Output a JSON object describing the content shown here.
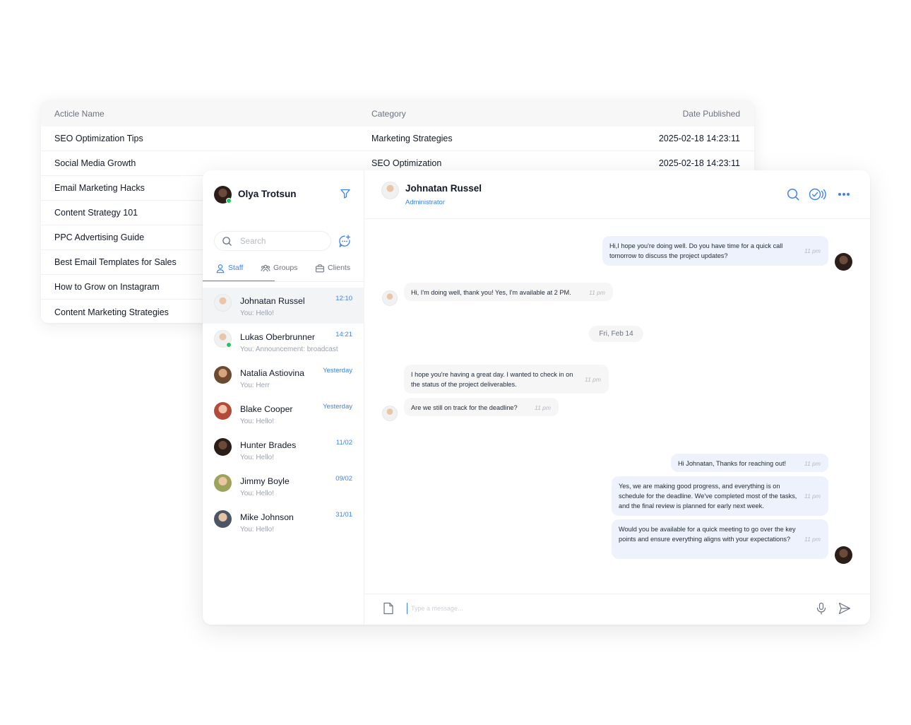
{
  "article_table": {
    "columns": [
      "Acticle Name",
      "Category",
      "Date Published"
    ],
    "rows": [
      [
        "SEO Optimization Tips",
        "Marketing Strategies",
        "2025-02-18 14:23:11"
      ],
      [
        "Social Media Growth",
        "SEO Optimization",
        "2025-02-18 14:23:11"
      ],
      [
        "Email Marketing Hacks",
        "",
        ""
      ],
      [
        "Content Strategy 101",
        "",
        ""
      ],
      [
        "PPC Advertising Guide",
        "",
        ""
      ],
      [
        "Best Email Templates for Sales",
        "",
        ""
      ],
      [
        "How to Grow on Instagram",
        "",
        ""
      ],
      [
        "Content Marketing Strategies",
        "",
        ""
      ]
    ]
  },
  "sidebar": {
    "user_name": "Olya Trotsun",
    "search_placeholder": "Search",
    "tabs": [
      {
        "label": "Staff",
        "icon": "person-icon",
        "active": true
      },
      {
        "label": "Groups",
        "icon": "group-icon",
        "active": false
      },
      {
        "label": "Clients",
        "icon": "briefcase-icon",
        "active": false
      }
    ],
    "contacts": [
      {
        "name": "Johnatan Russel",
        "preview": "You: Hello!",
        "time": "12:10",
        "active": true
      },
      {
        "name": "Lukas Oberbrunner",
        "preview": "You: Announcement: broadcast",
        "time": "14:21",
        "online": true
      },
      {
        "name": "Natalia Astiovina",
        "preview": "You: Herr",
        "time": "Yesterday"
      },
      {
        "name": "Blake Cooper",
        "preview": "You: Hello!",
        "time": "Yesterday"
      },
      {
        "name": "Hunter Brades",
        "preview": "You: Hello!",
        "time": "11/02"
      },
      {
        "name": "Jimmy Boyle",
        "preview": "You: Hello!",
        "time": "09/02"
      },
      {
        "name": "Mike Johnson",
        "preview": "You: Hello!",
        "time": "31/01"
      }
    ]
  },
  "chat": {
    "partner_name": "Johnatan Russel",
    "partner_role": "Administrator",
    "date_divider": "Fri, Feb 14",
    "input_placeholder": "Type a message...",
    "messages": [
      {
        "dir": "out",
        "text": "Hi,I hope you're doing well. Do you have time for a quick call tomorrow to discuss the project updates?",
        "time": "11 pm"
      },
      {
        "dir": "in",
        "text": "Hi, I'm doing well, thank you! Yes, I'm available at 2 PM.",
        "time": "11 pm"
      },
      {
        "dir": "in",
        "text": "I hope you're having a great day. I wanted to check in on the status of the project deliverables.",
        "time": "11 pm"
      },
      {
        "dir": "in",
        "text": "Are we still on track for the deadline?",
        "time": "11 pm"
      },
      {
        "dir": "out",
        "text": "Hi Johnatan, Thanks for reaching out!",
        "time": "11 pm"
      },
      {
        "dir": "out",
        "text": "Yes, we are making good progress, and everything is on schedule for the deadline. We've completed most of the tasks, and the final review is planned for early next week.",
        "time": "11 pm"
      },
      {
        "dir": "out",
        "text": "Would you be available for a quick meeting to go over the key points and ensure everything aligns with your expectations?",
        "time": "11 pm"
      }
    ]
  },
  "colors": {
    "accent": "#3b82f6",
    "online": "#22c55e",
    "bubble_out": "#eef2fc",
    "bubble_in": "#f6f6f7"
  }
}
